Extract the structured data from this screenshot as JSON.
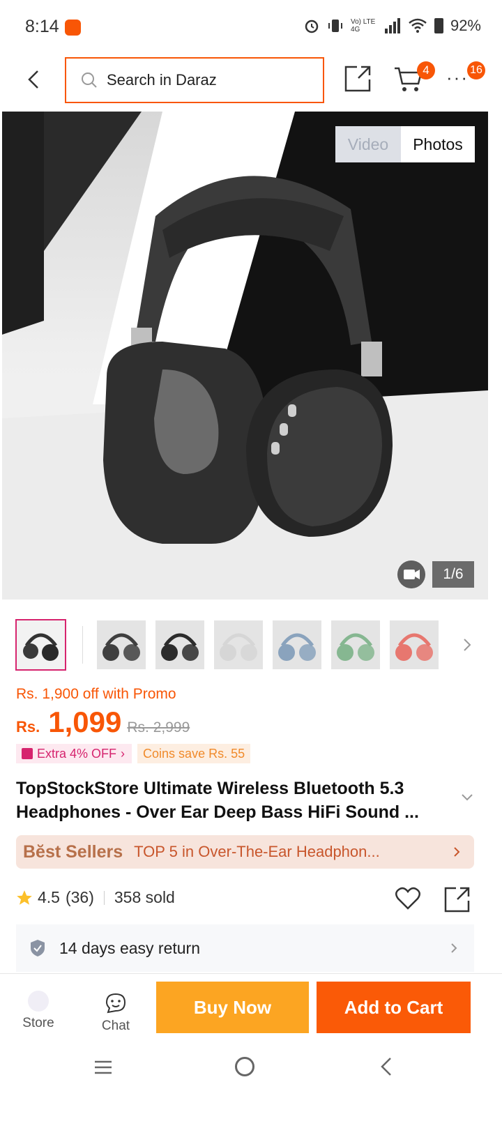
{
  "status_bar": {
    "time": "8:14",
    "network_label": "Vo) LTE 4G",
    "battery": "92%"
  },
  "header": {
    "search_placeholder": "Search in Daraz",
    "cart_count": "4",
    "more_count": "16"
  },
  "gallery": {
    "video_label": "Video",
    "photos_label": "Photos",
    "counter": "1/6",
    "thumbnail_colors": [
      "#3a3a3a",
      "#3f3f3f",
      "#2c2c2c",
      "#d6d6d6",
      "#8aa3bd",
      "#86b791",
      "#e7776f"
    ]
  },
  "pricing": {
    "promo": "Rs. 1,900 off with Promo",
    "currency": "Rs.",
    "price": "1,099",
    "original_price": "Rs. 2,999",
    "extra_off": "Extra 4% OFF",
    "coins_save": "Coins save Rs. 55"
  },
  "product": {
    "title": "TopStockStore Ultimate Wireless Bluetooth 5.3 Headphones - Over Ear Deep Bass HiFi Sound ..."
  },
  "best_sellers": {
    "label": "Bĕst Sellers",
    "text": "TOP 5 in Over-The-Ear Headphon..."
  },
  "rating": {
    "score": "4.5",
    "count": "(36)",
    "sold": "358 sold"
  },
  "return_policy": {
    "text": "14 days easy return"
  },
  "bottom_bar": {
    "store_label": "Store",
    "chat_label": "Chat",
    "buy_now": "Buy Now",
    "add_to_cart": "Add to Cart"
  },
  "colors": {
    "accent": "#f85606",
    "buy_now": "#fca522",
    "add_to_cart": "#fa5a07"
  }
}
